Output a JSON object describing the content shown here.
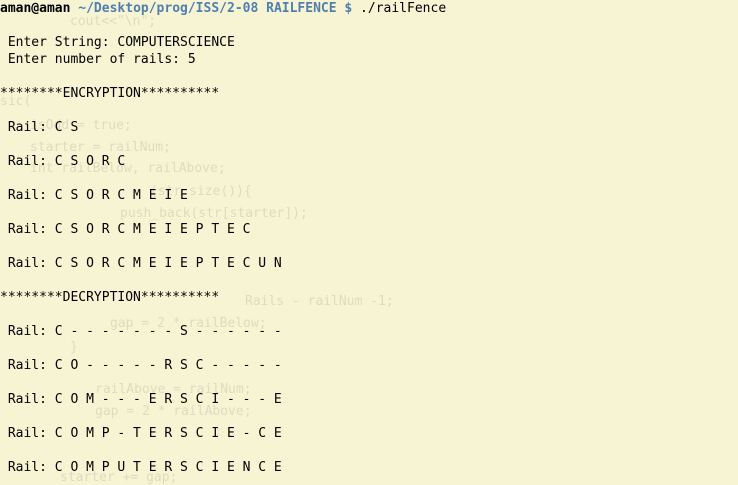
{
  "colors": {
    "background": "#f6f4d3",
    "text": "#000000",
    "prompt_path": "#4f7fb0"
  },
  "prompt": {
    "user_host": "aman@aman",
    "path": "~/Desktop/prog/ISS/2-08 RAILFENCE $",
    "command": "./railFence"
  },
  "output": {
    "enter_string": " Enter String: COMPUTERSCIENCE",
    "enter_rails": " Enter number of rails: 5",
    "encryption_header": "********ENCRYPTION**********",
    "encryption_rails": [
      " Rail: C S",
      " Rail: C S O R C",
      " Rail: C S O R C M E I E",
      " Rail: C S O R C M E I E P T E C",
      " Rail: C S O R C M E I E P T E C U N"
    ],
    "decryption_header": "********DECRYPTION**********",
    "decryption_rails": [
      " Rail: C - - - - - - - S - - - - - -",
      " Rail: C O - - - - - R S C - - - - -",
      " Rail: C O M - - - E R S C I - - - E",
      " Rail: C O M P - T E R S C I E - C E",
      " Rail: C O M P U T E R S C I E N C E"
    ]
  }
}
